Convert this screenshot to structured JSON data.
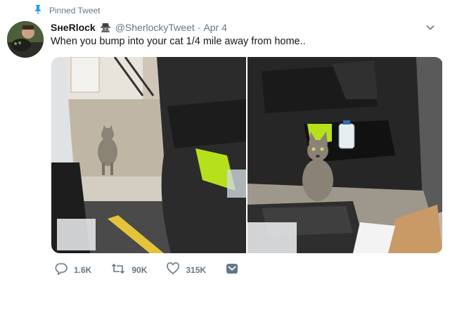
{
  "pinned": {
    "label": "Pinned Tweet",
    "icon": "pin-icon"
  },
  "author": {
    "name": "SʜeRlock",
    "badge_icon": "spy-icon",
    "handle": "@SherlockyTweet",
    "separator": "·",
    "date": "Apr 4"
  },
  "tweet": {
    "text": "When you bump into your cat 1/4 mile away from home.."
  },
  "actions": {
    "replies": "1.6K",
    "retweets": "90K",
    "likes": "315K"
  },
  "colors": {
    "muted": "#657786",
    "pin": "#1da1f2",
    "text": "#14171a"
  }
}
